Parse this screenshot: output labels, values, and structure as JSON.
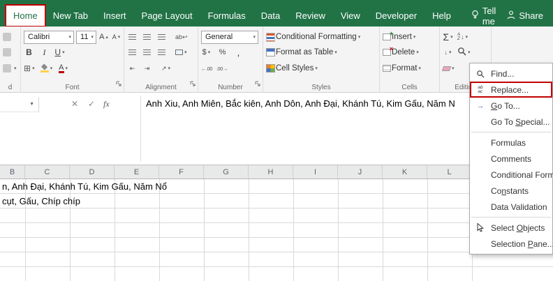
{
  "window": {
    "tabs": [
      {
        "label": "Home"
      },
      {
        "label": "New Tab"
      },
      {
        "label": "Insert"
      },
      {
        "label": "Page Layout"
      },
      {
        "label": "Formulas"
      },
      {
        "label": "Data"
      },
      {
        "label": "Review"
      },
      {
        "label": "View"
      },
      {
        "label": "Developer"
      },
      {
        "label": "Help"
      }
    ],
    "tell_me": "Tell me",
    "share": "Share"
  },
  "ribbon": {
    "clipboard_group": {
      "label_fragment": "d"
    },
    "font_group": {
      "label": "Font",
      "font_name": "Calibri",
      "font_size": "11",
      "bold": "B",
      "italic": "I",
      "underline": "U"
    },
    "alignment_group": {
      "label": "Alignment"
    },
    "number_group": {
      "label": "Number",
      "format": "General",
      "currency": "$",
      "percent": "%",
      "comma": ","
    },
    "styles_group": {
      "label": "Styles",
      "items": [
        "Conditional Formatting",
        "Format as Table",
        "Cell Styles"
      ]
    },
    "cells_group": {
      "label": "Cells",
      "items": [
        "Insert",
        "Delete",
        "Format"
      ]
    },
    "editing_group": {
      "label": "Editing",
      "autosum": "Σ"
    }
  },
  "formula_bar": {
    "cancel": "✕",
    "enter": "✓",
    "fx": "fx",
    "content": "Anh Xiu, Anh Miên, Bắc kiên, Anh Dôn, Anh Đại, Khánh Tú, Kim Gấu, Năm N"
  },
  "sheet": {
    "columns": [
      "B",
      "C",
      "D",
      "E",
      "F",
      "G",
      "H",
      "I",
      "J",
      "K",
      "L"
    ],
    "rows": [
      {
        "text": "n, Anh Đại, Khánh Tú, Kim Gấu, Năm Nổ"
      },
      {
        "text": "cụt, Gấu, Chíp chíp"
      }
    ]
  },
  "find_select_menu": {
    "items": [
      {
        "label": "Find...",
        "icon": "search"
      },
      {
        "label": "Replace...",
        "icon": "replace",
        "highlighted": true
      },
      {
        "label": "Go To...",
        "icon": "goto-arrow",
        "underline": "G"
      },
      {
        "label": "Go To Special...",
        "underline": "S"
      },
      {
        "label": "Formulas"
      },
      {
        "label": "Comments"
      },
      {
        "label": "Conditional Formatting"
      },
      {
        "label": "Constants",
        "underline": "n"
      },
      {
        "label": "Data Validation"
      },
      {
        "label": "Select Objects",
        "icon": "cursor",
        "underline": "O"
      },
      {
        "label": "Selection Pane...",
        "underline": "P"
      }
    ]
  },
  "colors": {
    "excel_green": "#217346",
    "highlight_red": "#c00000"
  }
}
